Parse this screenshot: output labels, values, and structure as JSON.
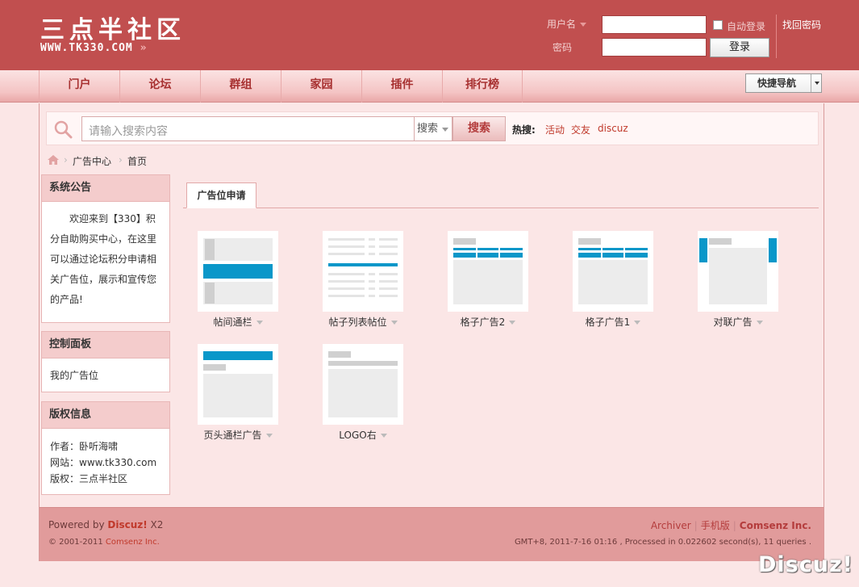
{
  "logo": {
    "title": "三点半社区",
    "url": "WWW.TK330.COM",
    "arrows": "»"
  },
  "login": {
    "username_label": "用户名",
    "password_label": "密码",
    "username_value": "",
    "password_value": "",
    "remember_label": "自动登录",
    "login_button": "登录",
    "forgot_label": "找回密码"
  },
  "nav": {
    "items": [
      "门户",
      "论坛",
      "群组",
      "家园",
      "插件",
      "排行榜"
    ],
    "quick_nav": "快捷导航"
  },
  "search": {
    "placeholder": "请输入搜索内容",
    "type_label": "搜索",
    "button": "搜索",
    "hot_label": "热搜:",
    "hot_terms": [
      "活动",
      "交友",
      "discuz"
    ]
  },
  "breadcrumb": [
    "广告中心",
    "首页"
  ],
  "sidebar": {
    "notice": {
      "title": "系统公告",
      "body": "欢迎来到【330】积分自助购买中心，在这里可以通过论坛积分申请相关广告位，展示和宣传您的产品!"
    },
    "panel": {
      "title": "控制面板",
      "item": "我的广告位"
    },
    "copyright": {
      "title": "版权信息",
      "lines": [
        "作者：卧听海啸",
        "网站：www.tk330.com",
        "版权：三点半社区"
      ]
    }
  },
  "main": {
    "tab": "广告位申请",
    "ads": [
      "帖间通栏",
      "帖子列表帖位",
      "格子广告2",
      "格子广告1",
      "对联广告",
      "页头通栏广告",
      "LOGO右"
    ]
  },
  "footer": {
    "powered_prefix": "Powered by ",
    "powered_brand": "Discuz!",
    "powered_version": " X2",
    "copyright_prefix": "© 2001-2011 ",
    "copyright_brand": "Comsenz Inc.",
    "links": [
      "Archiver",
      "手机版",
      "Comsenz Inc."
    ],
    "stats": "GMT+8, 2011-7-16 01:16 , Processed in 0.022602 second(s), 11 queries ."
  },
  "watermark": "Discuz!",
  "colors": {
    "header": "#c14f4f",
    "accent": "#c0392b",
    "ad_blue": "#0a97c9",
    "footer": "#e19b9b"
  }
}
